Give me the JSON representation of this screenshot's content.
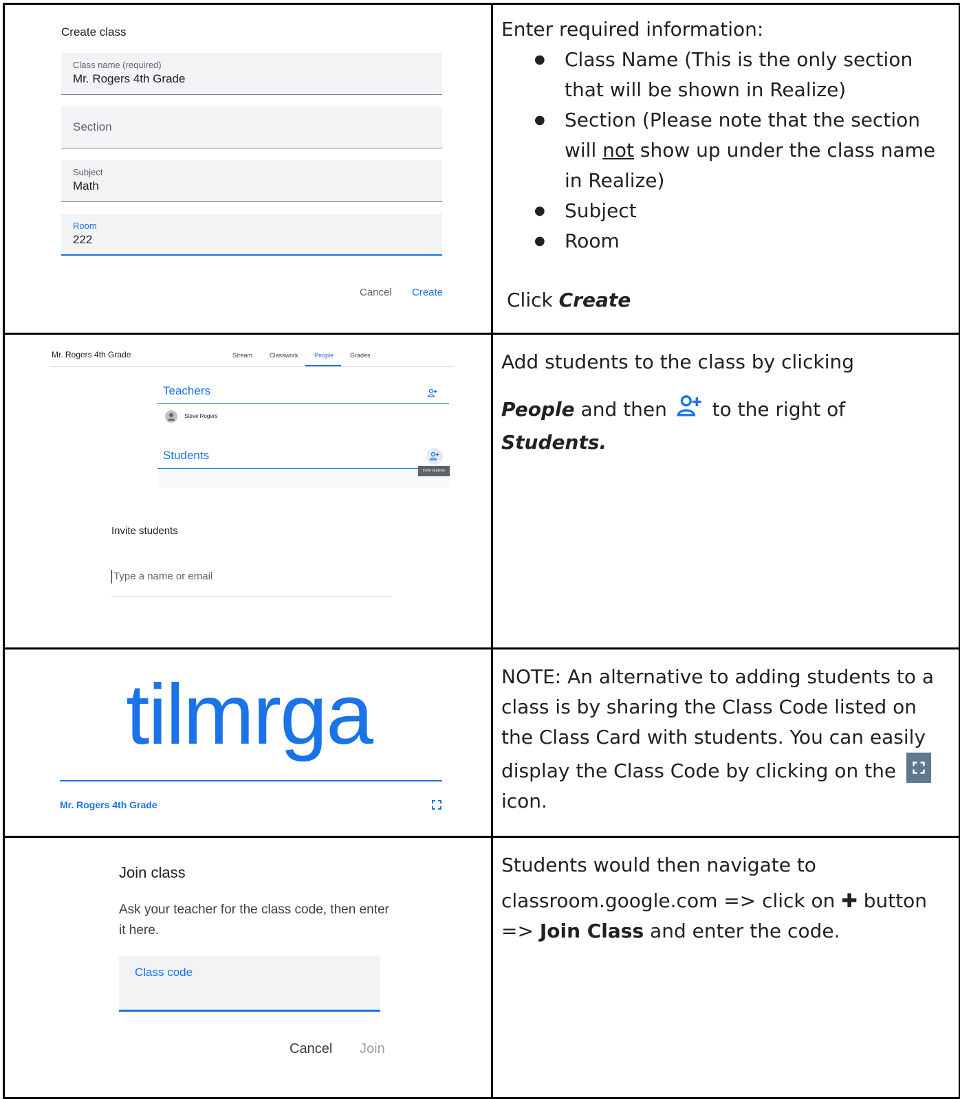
{
  "row1": {
    "dialog_title": "Create class",
    "fields": [
      {
        "label": "Class name (required)",
        "value": "Mr. Rogers 4th Grade"
      },
      {
        "label": "",
        "placeholder": "Section",
        "value": ""
      },
      {
        "label": "Subject",
        "value": "Math"
      },
      {
        "label": "Room",
        "value": "222"
      }
    ],
    "cancel_label": "Cancel",
    "create_label": "Create",
    "instructions_title": "Enter required information:",
    "bullets": [
      "Class Name (This is the only section that will be shown in Realize)",
      "Section (Please note that the section will not show up under the class name in Realize)",
      "Subject",
      "Room"
    ],
    "bullet2_parts": [
      "Section (Please note that the section will ",
      "not",
      " show up under the class name in Realize)"
    ],
    "click_prefix": "Click ",
    "click_bold": "Create"
  },
  "row2": {
    "class_name": "Mr. Rogers 4th Grade",
    "tabs": [
      "Stream",
      "Classwork",
      "People",
      "Grades"
    ],
    "teachers_heading": "Teachers",
    "teacher_name": "Steve Rogers",
    "students_heading": "Students",
    "tooltip": "Invite students",
    "invite_title": "Invite students",
    "invite_placeholder": "Type a name or email",
    "text_line1": "Add students to the class by clicking",
    "text_people": "People",
    "text_and_then": " and then ",
    "text_to_right": " to the right of",
    "text_students": "Students."
  },
  "row3": {
    "class_code": "tilmrga",
    "class_name": "Mr. Rogers 4th Grade",
    "note_text": "NOTE:  An alternative to adding students to a class is by sharing the Class Code listed on the Class Card with students.  You can easily display the Class Code by clicking on the",
    "note_icon_suffix": "icon."
  },
  "row4": {
    "dialog_title": "Join class",
    "dialog_body": "Ask your teacher for the class code, then enter it here.",
    "field_label": "Class code",
    "cancel_label": "Cancel",
    "join_label": "Join",
    "text_line1": "Students would then navigate to",
    "text_part1": "classroom.google.com => click on ",
    "plus_glyph": "✚",
    "text_part2": " button => ",
    "text_bold": "Join Class",
    "text_part3": " and enter the code."
  },
  "colors": {
    "accent": "#1a73e8",
    "border": "#000000",
    "field_bg": "#f1f3f4"
  }
}
